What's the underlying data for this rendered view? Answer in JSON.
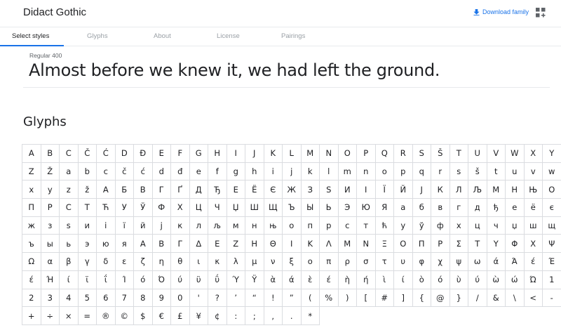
{
  "header": {
    "font_name": "Didact Gothic",
    "download_label": "Download family"
  },
  "tabs": [
    "Select styles",
    "Glyphs",
    "About",
    "License",
    "Pairings"
  ],
  "style": {
    "label": "Regular 400",
    "sample_text": "Almost before we knew it, we had left the ground."
  },
  "glyphs_heading": "Glyphs",
  "glyphs": [
    "A",
    "B",
    "C",
    "Č",
    "Ć",
    "D",
    "Đ",
    "E",
    "F",
    "G",
    "H",
    "I",
    "J",
    "K",
    "L",
    "M",
    "N",
    "O",
    "P",
    "Q",
    "R",
    "S",
    "Š",
    "T",
    "U",
    "V",
    "W",
    "X",
    "Y",
    "Z",
    "Ž",
    "a",
    "b",
    "c",
    "č",
    "ć",
    "d",
    "đ",
    "e",
    "f",
    "g",
    "h",
    "i",
    "j",
    "k",
    "l",
    "m",
    "n",
    "o",
    "p",
    "q",
    "r",
    "s",
    "š",
    "t",
    "u",
    "v",
    "w",
    "x",
    "y",
    "z",
    "ž",
    "А",
    "Б",
    "В",
    "Г",
    "Ґ",
    "Д",
    "Ђ",
    "Е",
    "Ё",
    "Є",
    "Ж",
    "З",
    "Ѕ",
    "И",
    "І",
    "Ї",
    "Й",
    "Ј",
    "К",
    "Л",
    "Љ",
    "М",
    "Н",
    "Њ",
    "О",
    "П",
    "Р",
    "С",
    "Т",
    "Ћ",
    "У",
    "Ў",
    "Ф",
    "Х",
    "Ц",
    "Ч",
    "Џ",
    "Ш",
    "Щ",
    "Ъ",
    "Ы",
    "Ь",
    "Э",
    "Ю",
    "Я",
    "а",
    "б",
    "в",
    "г",
    "д",
    "ђ",
    "е",
    "ё",
    "є",
    "ж",
    "з",
    "ѕ",
    "и",
    "і",
    "ї",
    "й",
    "ј",
    "к",
    "л",
    "љ",
    "м",
    "н",
    "њ",
    "о",
    "п",
    "р",
    "с",
    "т",
    "ћ",
    "у",
    "ў",
    "ф",
    "х",
    "ц",
    "ч",
    "џ",
    "ш",
    "щ",
    "ъ",
    "ы",
    "ь",
    "э",
    "ю",
    "я",
    "Α",
    "Β",
    "Γ",
    "Δ",
    "Ε",
    "Ζ",
    "Η",
    "Θ",
    "Ι",
    "Κ",
    "Λ",
    "Μ",
    "Ν",
    "Ξ",
    "Ο",
    "Π",
    "Ρ",
    "Σ",
    "Τ",
    "Υ",
    "Φ",
    "Χ",
    "Ψ",
    "Ω",
    "α",
    "β",
    "γ",
    "δ",
    "ε",
    "ζ",
    "η",
    "θ",
    "ι",
    "κ",
    "λ",
    "μ",
    "ν",
    "ξ",
    "ο",
    "π",
    "ρ",
    "σ",
    "τ",
    "υ",
    "φ",
    "χ",
    "ψ",
    "ω",
    "ά",
    "Ά",
    "έ",
    "Έ",
    "έ",
    "Ή",
    "ί",
    "ϊ",
    "ΐ",
    "Ί",
    "ό",
    "Ό",
    "ύ",
    "ϋ",
    "ΰ",
    "Ύ",
    "Ϋ",
    "ὰ",
    "ά",
    "ὲ",
    "έ",
    "ὴ",
    "ή",
    "ὶ",
    "ί",
    "ὸ",
    "ό",
    "ὺ",
    "ύ",
    "ὼ",
    "ώ",
    "Ώ",
    "1",
    "2",
    "3",
    "4",
    "5",
    "6",
    "7",
    "8",
    "9",
    "0",
    "'",
    "?",
    "’",
    "“",
    "!",
    "”",
    "(",
    "%",
    ")",
    "[",
    "#",
    "]",
    "{",
    "@",
    "}",
    "/",
    "&",
    "\\",
    "<",
    "-",
    "+",
    "÷",
    "×",
    "=",
    "®",
    "©",
    "$",
    "€",
    "£",
    "¥",
    "¢",
    ":",
    ";",
    ",",
    ".",
    "*"
  ]
}
